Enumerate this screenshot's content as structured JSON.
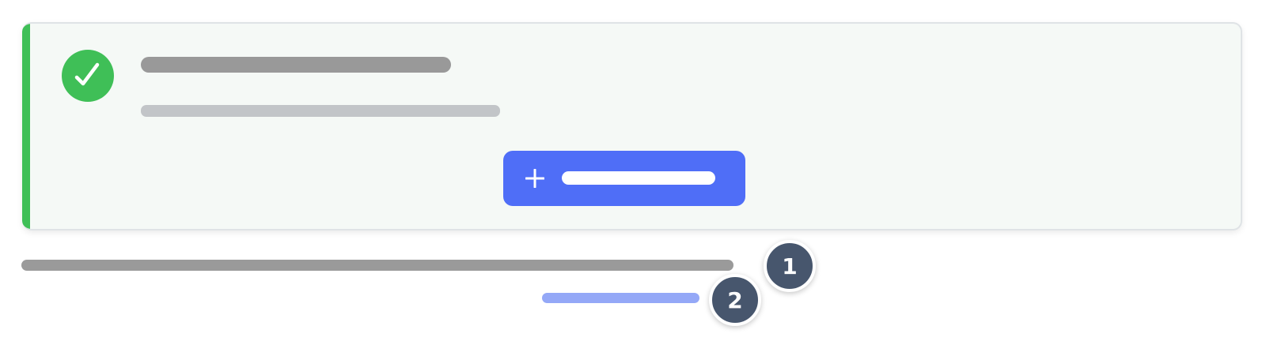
{
  "success_card": {
    "icon": "check-circle-icon",
    "title": "",
    "subtitle": "",
    "action_button": {
      "icon": "plus-icon",
      "label": ""
    }
  },
  "footer": {
    "line_1": "",
    "line_2": ""
  },
  "badges": [
    "1",
    "2"
  ],
  "colors": {
    "success": "#3fbf57",
    "card_background": "#f5f9f6",
    "primary": "#4f6ef7",
    "badge": "#47566d",
    "skeleton_dark": "#999999",
    "skeleton_light": "#c2c5c8",
    "link_skeleton": "#94a8f7"
  }
}
